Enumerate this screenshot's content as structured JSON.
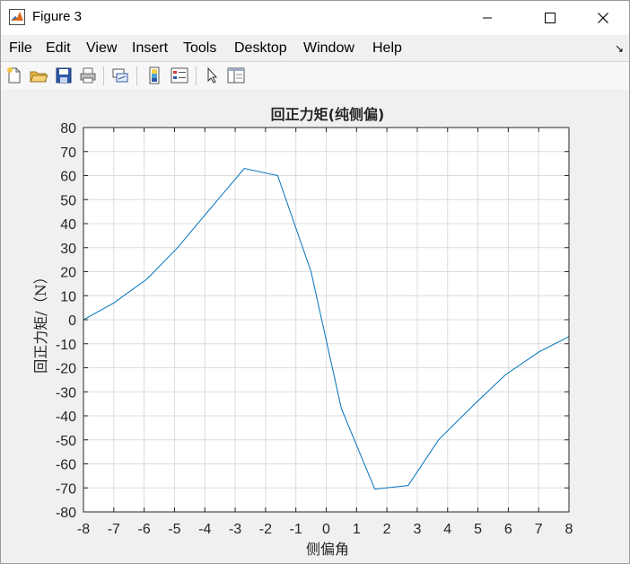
{
  "window": {
    "title": "Figure 3"
  },
  "menu": {
    "items": [
      "File",
      "Edit",
      "View",
      "Insert",
      "Tools",
      "Desktop",
      "Window",
      "Help"
    ]
  },
  "toolbar": {
    "icons": [
      "new-figure-icon",
      "open-file-icon",
      "save-icon",
      "print-icon",
      "link-plot-icon",
      "insert-colorbar-icon",
      "insert-legend-icon",
      "pointer-icon",
      "property-editor-icon"
    ]
  },
  "colors": {
    "line": "#0072bd",
    "grid": "#dcdcdc",
    "axes_bg": "#ffffff"
  },
  "chart_data": {
    "type": "line",
    "title": "回正力矩(纯侧偏)",
    "xlabel": "侧偏角",
    "ylabel": "回正力矩/（N）",
    "xlim": [
      -8,
      8
    ],
    "ylim": [
      -80,
      80
    ],
    "xticks": [
      -8,
      -7,
      -6,
      -5,
      -4,
      -3,
      -2,
      -1,
      0,
      1,
      2,
      3,
      4,
      5,
      6,
      7,
      8
    ],
    "yticks": [
      -80,
      -70,
      -60,
      -50,
      -40,
      -30,
      -20,
      -10,
      0,
      10,
      20,
      30,
      40,
      50,
      60,
      70,
      80
    ],
    "grid": true,
    "series": [
      {
        "x": [
          -8,
          -7.0,
          -5.9,
          -4.9,
          -3.9,
          -3.7,
          -2.7,
          -1.6,
          -0.5,
          0.5,
          1.6,
          2.7,
          3.7,
          4.9,
          5.9,
          7.0,
          8
        ],
        "y": [
          0,
          7,
          17,
          30,
          45,
          48,
          63,
          60,
          20,
          -37,
          -70.5,
          -69,
          -50,
          -35,
          -23,
          -13.5,
          -7
        ]
      }
    ]
  }
}
